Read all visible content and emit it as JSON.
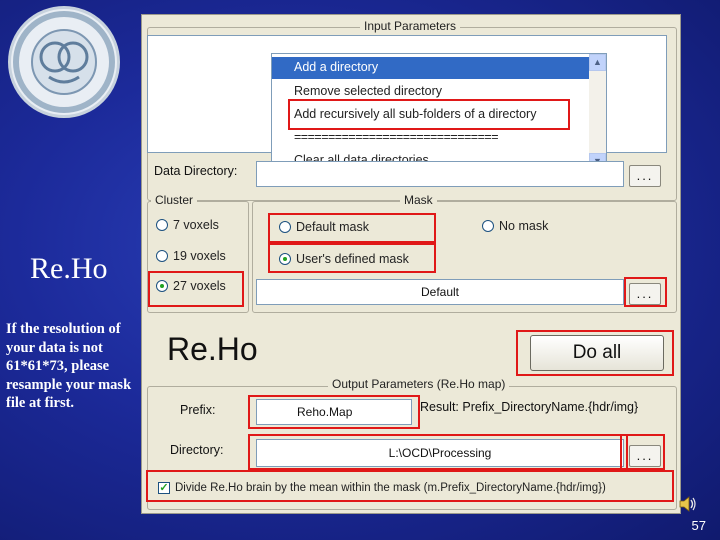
{
  "slide": {
    "title": "Re.Ho",
    "note": "If the resolution of your data is not 61*61*73, please resample your mask file at first.",
    "page_number": "57"
  },
  "icons": {
    "logo": "institution-logo",
    "speaker": "speaker-icon",
    "scroll_up": "chevron-up-icon",
    "scroll_down": "chevron-down-icon"
  },
  "colors": {
    "highlight_box": "#e01818",
    "selection": "#316ac5",
    "background": "#1c2a9a"
  },
  "app": {
    "input_group_title": "Input Parameters",
    "data_directory_label": "Data Directory:",
    "data_directory_value": "",
    "browse_label": "...",
    "dropdown": {
      "items": [
        "Add a directory",
        "Remove selected directory",
        "Add recursively all sub-folders of a directory",
        "==============================",
        "Clear all data directories"
      ],
      "selected": "Add a directory"
    },
    "cluster": {
      "title": "Cluster",
      "options": [
        "7 voxels",
        "19 voxels",
        "27 voxels"
      ],
      "selected": "27 voxels"
    },
    "mask": {
      "title": "Mask",
      "default_label": "Default mask",
      "none_label": "No mask",
      "user_label": "User's defined mask",
      "selected": "User's defined mask",
      "file_value": "Default",
      "browse_label": "..."
    },
    "title": "Re.Ho",
    "do_all_label": "Do all",
    "output": {
      "title": "Output Parameters (Re.Ho map)",
      "prefix_label": "Prefix:",
      "prefix_value": "Reho.Map",
      "result_text": "Result: Prefix_DirectoryName.{hdr/img}",
      "directory_label": "Directory:",
      "directory_value": "L:\\OCD\\Processing",
      "browse_label": "...",
      "divide_label": "Divide Re.Ho brain by the mean within the mask (m.Prefix_DirectoryName.{hdr/img})",
      "divide_checked": true
    }
  }
}
